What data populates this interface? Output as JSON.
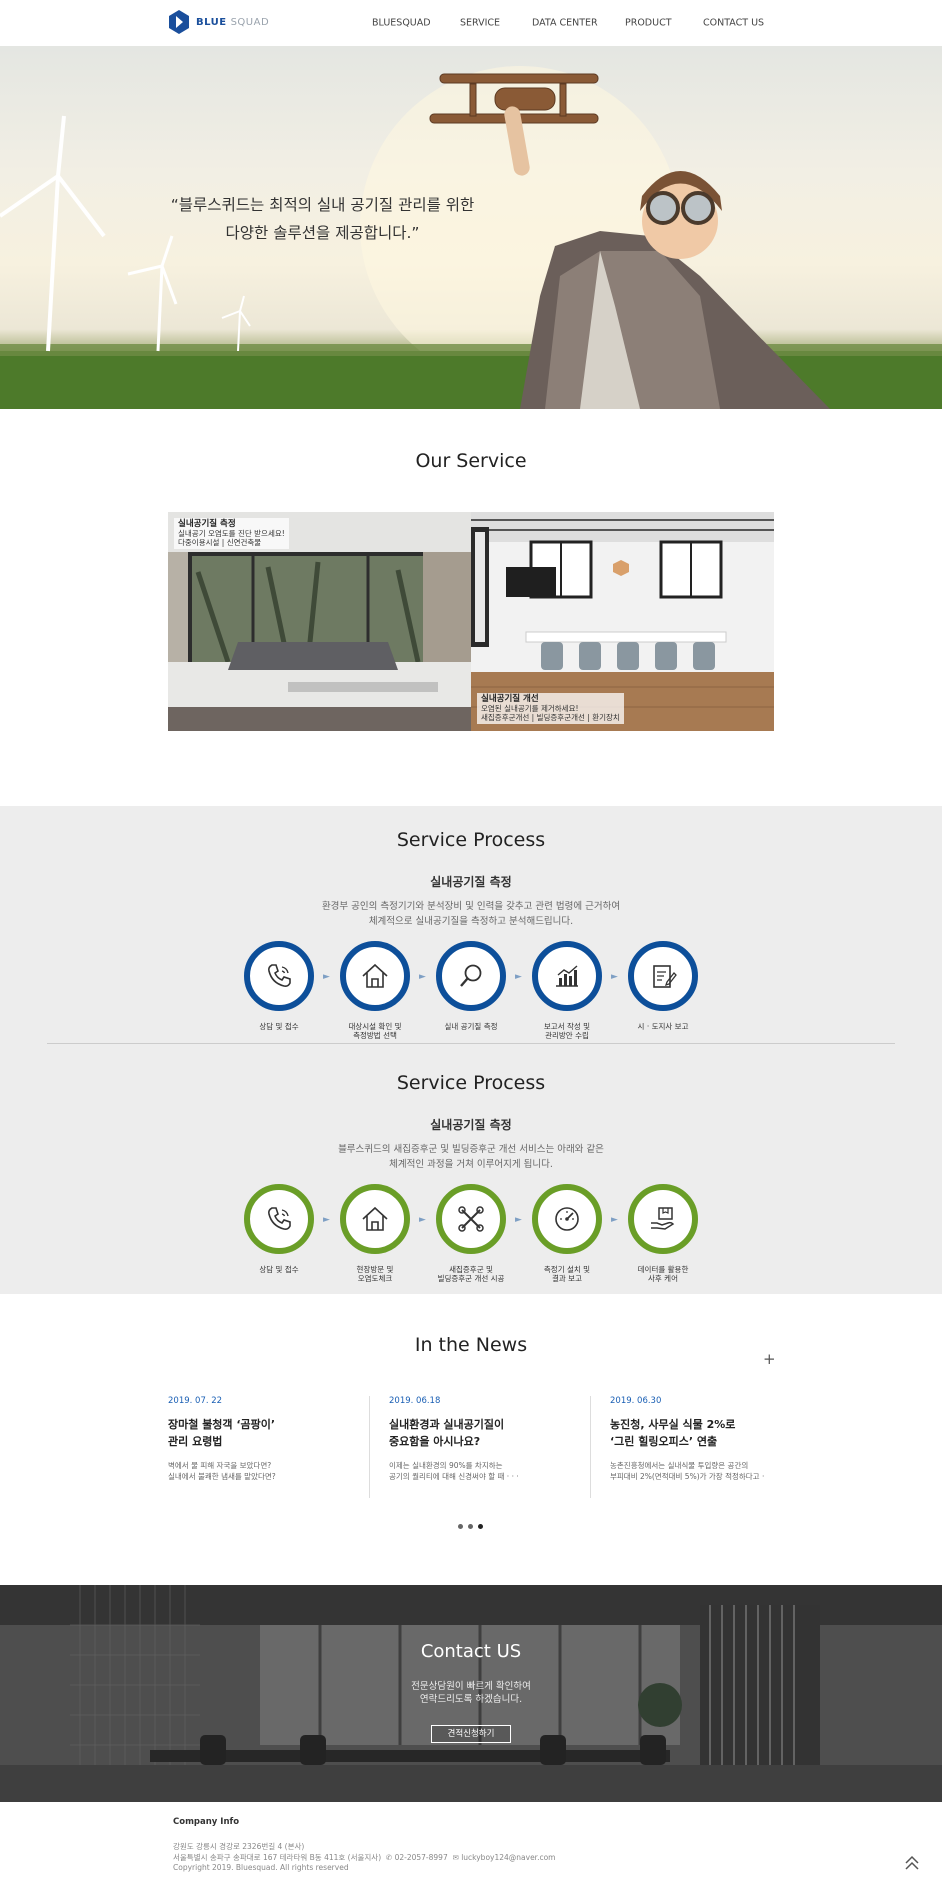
{
  "header": {
    "logo_primary": "BLUE",
    "logo_secondary": "SQUAD",
    "nav": [
      "BLUESQUAD",
      "SERVICE",
      "DATA CENTER",
      "PRODUCT",
      "CONTACT US"
    ]
  },
  "hero": {
    "quote_line1": "“블루스퀴드는 최적의 실내 공기질 관리를 위한",
    "quote_line2": "다양한 솔루션을 제공합니다.”"
  },
  "our_service": {
    "title": "Our Service",
    "cards": [
      {
        "title": "실내공기질 측정",
        "line1": "실내공기 오염도를 진단 받으세요!",
        "line2": "다중이용시설 | 신연건축물"
      },
      {
        "title": "실내공기질 개선",
        "line1": "오염된 실내공기를 제거하세요!",
        "line2": "새집증후군개선 | 빌딩증후군개선 | 환기장치"
      }
    ]
  },
  "process1": {
    "title": "Service Process",
    "subtitle": "실내공기질 측정",
    "desc1": "환경부 공인의 측정기기와 분석장비 및 인력을 갖추고 관련 법령에 근거하여",
    "desc2": "체계적으로 실내공기질을 측정하고 분석해드립니다.",
    "steps": [
      {
        "icon": "phone-icon",
        "l1": "상담 및 접수",
        "l2": ""
      },
      {
        "icon": "house-icon",
        "l1": "대상시설 확인 및",
        "l2": "측정방법 선택"
      },
      {
        "icon": "magnifier-icon",
        "l1": "실내 공기질 측정",
        "l2": ""
      },
      {
        "icon": "bar-chart-icon",
        "l1": "보고서 작성 및",
        "l2": "관리방안 수립"
      },
      {
        "icon": "report-icon",
        "l1": "시 · 도지사 보고",
        "l2": ""
      }
    ]
  },
  "process2": {
    "title": "Service Process",
    "subtitle": "실내공기질 측정",
    "desc1": "블루스퀴드의 새집증후군 및 빌딩증후군 개선 서비스는 아래와 같은",
    "desc2": "체계적인 과정을 거쳐 이루어지게 됩니다.",
    "steps": [
      {
        "icon": "phone-icon",
        "l1": "상담 및 접수",
        "l2": ""
      },
      {
        "icon": "house-icon",
        "l1": "현장방문 및",
        "l2": "오염도체크"
      },
      {
        "icon": "tools-icon",
        "l1": "새집증후군 및",
        "l2": "빌딩증후군 개선 시공"
      },
      {
        "icon": "gauge-icon",
        "l1": "측정기 설치 및",
        "l2": "결과 보고"
      },
      {
        "icon": "box-hand-icon",
        "l1": "데이터를 활용한",
        "l2": "사후 케어"
      }
    ]
  },
  "news": {
    "title": "In the News",
    "more": "+",
    "items": [
      {
        "date": "2019. 07. 22",
        "t1": "장마철 불청객 ‘곰팡이’",
        "t2": "관리 요령법",
        "b1": "벽에서 물 피해 자국을 보았다면?",
        "b2": "실내에서 불쾌한 냄새를 맡았다면?"
      },
      {
        "date": "2019. 06.18",
        "t1": "실내환경과 실내공기질이",
        "t2": "중요함을 아시나요?",
        "b1": "이제는 실내환경의 90%를 차지하는",
        "b2": "공기의 퀄리티에 대해 신경써야 할 때 · · ·"
      },
      {
        "date": "2019. 06.30",
        "t1": "농진청, 사무실 식물 2%로",
        "t2": "‘그린 힐링오피스’ 연출",
        "b1": "농촌진흥청에서는 실내식물 투입량은 공간의",
        "b2": "부피대비 2%(면적대비 5%)가 가장 적정하다고 ·"
      }
    ]
  },
  "contact": {
    "title": "Contact US",
    "desc1": "전문상담원이 빠르게 확인하여",
    "desc2": "연락드리도록 하겠습니다.",
    "button": "견적신청하기"
  },
  "footer": {
    "title": "Company Info",
    "addr1": "강원도 강릉시 경강로 2326번길 4 (본사)",
    "addr2": "서울특별시 송파구 송파대로 167 테라타워 B동 411호 (서울지사)",
    "phone": "02-2057-8997",
    "email": "luckyboy124@naver.com",
    "copyright": "Copyright 2019. Bluesquad. All rights reserved"
  }
}
